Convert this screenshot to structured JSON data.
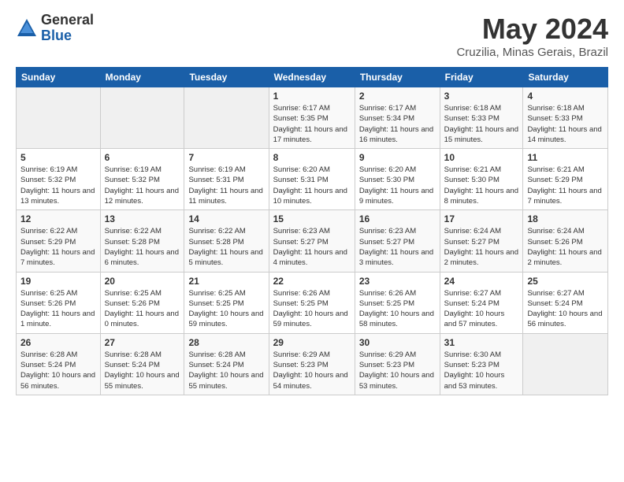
{
  "logo": {
    "general": "General",
    "blue": "Blue"
  },
  "title": "May 2024",
  "location": "Cruzilia, Minas Gerais, Brazil",
  "days_of_week": [
    "Sunday",
    "Monday",
    "Tuesday",
    "Wednesday",
    "Thursday",
    "Friday",
    "Saturday"
  ],
  "weeks": [
    [
      {
        "day": "",
        "info": ""
      },
      {
        "day": "",
        "info": ""
      },
      {
        "day": "",
        "info": ""
      },
      {
        "day": "1",
        "info": "Sunrise: 6:17 AM\nSunset: 5:35 PM\nDaylight: 11 hours and 17 minutes."
      },
      {
        "day": "2",
        "info": "Sunrise: 6:17 AM\nSunset: 5:34 PM\nDaylight: 11 hours and 16 minutes."
      },
      {
        "day": "3",
        "info": "Sunrise: 6:18 AM\nSunset: 5:33 PM\nDaylight: 11 hours and 15 minutes."
      },
      {
        "day": "4",
        "info": "Sunrise: 6:18 AM\nSunset: 5:33 PM\nDaylight: 11 hours and 14 minutes."
      }
    ],
    [
      {
        "day": "5",
        "info": "Sunrise: 6:19 AM\nSunset: 5:32 PM\nDaylight: 11 hours and 13 minutes."
      },
      {
        "day": "6",
        "info": "Sunrise: 6:19 AM\nSunset: 5:32 PM\nDaylight: 11 hours and 12 minutes."
      },
      {
        "day": "7",
        "info": "Sunrise: 6:19 AM\nSunset: 5:31 PM\nDaylight: 11 hours and 11 minutes."
      },
      {
        "day": "8",
        "info": "Sunrise: 6:20 AM\nSunset: 5:31 PM\nDaylight: 11 hours and 10 minutes."
      },
      {
        "day": "9",
        "info": "Sunrise: 6:20 AM\nSunset: 5:30 PM\nDaylight: 11 hours and 9 minutes."
      },
      {
        "day": "10",
        "info": "Sunrise: 6:21 AM\nSunset: 5:30 PM\nDaylight: 11 hours and 8 minutes."
      },
      {
        "day": "11",
        "info": "Sunrise: 6:21 AM\nSunset: 5:29 PM\nDaylight: 11 hours and 7 minutes."
      }
    ],
    [
      {
        "day": "12",
        "info": "Sunrise: 6:22 AM\nSunset: 5:29 PM\nDaylight: 11 hours and 7 minutes."
      },
      {
        "day": "13",
        "info": "Sunrise: 6:22 AM\nSunset: 5:28 PM\nDaylight: 11 hours and 6 minutes."
      },
      {
        "day": "14",
        "info": "Sunrise: 6:22 AM\nSunset: 5:28 PM\nDaylight: 11 hours and 5 minutes."
      },
      {
        "day": "15",
        "info": "Sunrise: 6:23 AM\nSunset: 5:27 PM\nDaylight: 11 hours and 4 minutes."
      },
      {
        "day": "16",
        "info": "Sunrise: 6:23 AM\nSunset: 5:27 PM\nDaylight: 11 hours and 3 minutes."
      },
      {
        "day": "17",
        "info": "Sunrise: 6:24 AM\nSunset: 5:27 PM\nDaylight: 11 hours and 2 minutes."
      },
      {
        "day": "18",
        "info": "Sunrise: 6:24 AM\nSunset: 5:26 PM\nDaylight: 11 hours and 2 minutes."
      }
    ],
    [
      {
        "day": "19",
        "info": "Sunrise: 6:25 AM\nSunset: 5:26 PM\nDaylight: 11 hours and 1 minute."
      },
      {
        "day": "20",
        "info": "Sunrise: 6:25 AM\nSunset: 5:26 PM\nDaylight: 11 hours and 0 minutes."
      },
      {
        "day": "21",
        "info": "Sunrise: 6:25 AM\nSunset: 5:25 PM\nDaylight: 10 hours and 59 minutes."
      },
      {
        "day": "22",
        "info": "Sunrise: 6:26 AM\nSunset: 5:25 PM\nDaylight: 10 hours and 59 minutes."
      },
      {
        "day": "23",
        "info": "Sunrise: 6:26 AM\nSunset: 5:25 PM\nDaylight: 10 hours and 58 minutes."
      },
      {
        "day": "24",
        "info": "Sunrise: 6:27 AM\nSunset: 5:24 PM\nDaylight: 10 hours and 57 minutes."
      },
      {
        "day": "25",
        "info": "Sunrise: 6:27 AM\nSunset: 5:24 PM\nDaylight: 10 hours and 56 minutes."
      }
    ],
    [
      {
        "day": "26",
        "info": "Sunrise: 6:28 AM\nSunset: 5:24 PM\nDaylight: 10 hours and 56 minutes."
      },
      {
        "day": "27",
        "info": "Sunrise: 6:28 AM\nSunset: 5:24 PM\nDaylight: 10 hours and 55 minutes."
      },
      {
        "day": "28",
        "info": "Sunrise: 6:28 AM\nSunset: 5:24 PM\nDaylight: 10 hours and 55 minutes."
      },
      {
        "day": "29",
        "info": "Sunrise: 6:29 AM\nSunset: 5:23 PM\nDaylight: 10 hours and 54 minutes."
      },
      {
        "day": "30",
        "info": "Sunrise: 6:29 AM\nSunset: 5:23 PM\nDaylight: 10 hours and 53 minutes."
      },
      {
        "day": "31",
        "info": "Sunrise: 6:30 AM\nSunset: 5:23 PM\nDaylight: 10 hours and 53 minutes."
      },
      {
        "day": "",
        "info": ""
      }
    ]
  ]
}
